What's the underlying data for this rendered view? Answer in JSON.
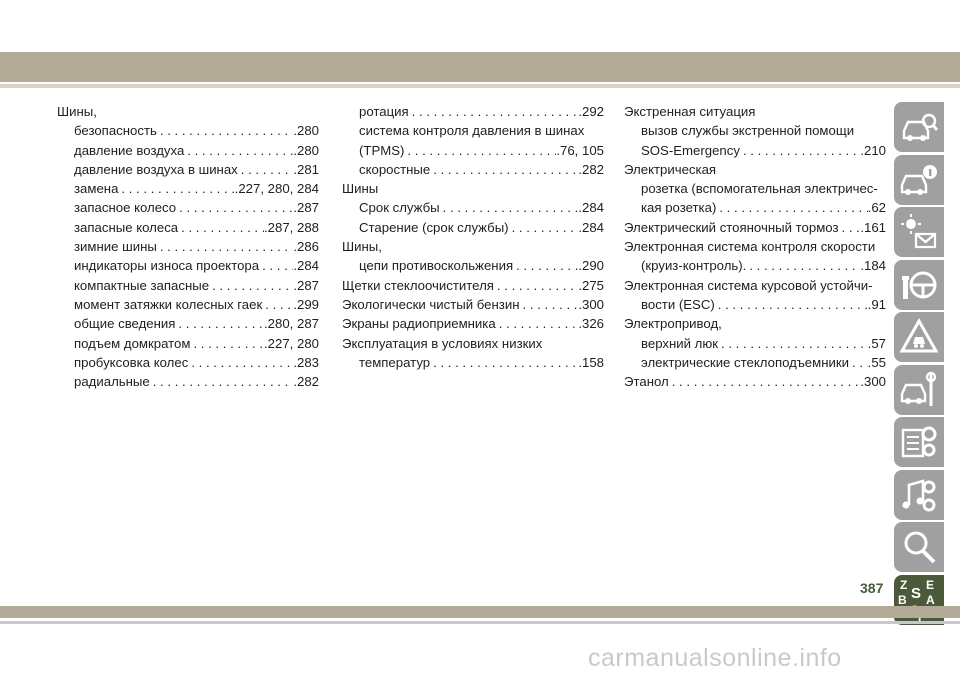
{
  "columns": [
    [
      {
        "level": 0,
        "text": "Шины,",
        "page": ""
      },
      {
        "level": 1,
        "text": "безопасность",
        "page": ".280"
      },
      {
        "level": 1,
        "text": "давление воздуха",
        "page": ".280"
      },
      {
        "level": 1,
        "text": "давление воздуха в шинах",
        "page": ".281"
      },
      {
        "level": 1,
        "text": "замена",
        "page": ".227, 280, 284"
      },
      {
        "level": 1,
        "text": "запасное колесо",
        "page": ".287"
      },
      {
        "level": 1,
        "text": "запасные колеса",
        "page": ".287, 288"
      },
      {
        "level": 1,
        "text": "зимние шины",
        "page": ".286"
      },
      {
        "level": 1,
        "text": "индикаторы износа проектора",
        "page": ".284"
      },
      {
        "level": 1,
        "text": "компактные запасные",
        "page": ".287"
      },
      {
        "level": 1,
        "text": "момент затяжки колесных гаек",
        "page": ".299"
      },
      {
        "level": 1,
        "text": "общие сведения",
        "page": ".280, 287"
      },
      {
        "level": 1,
        "text": "подъем домкратом",
        "page": ".227, 280"
      },
      {
        "level": 1,
        "text": "пробуксовка колес",
        "page": ".283"
      },
      {
        "level": 1,
        "text": "радиальные",
        "page": ".282"
      }
    ],
    [
      {
        "level": 1,
        "text": "ротация",
        "page": ".292"
      },
      {
        "level": 1,
        "text": "система контроля давления в шинах",
        "page": ""
      },
      {
        "level": 1,
        "text": "(TPMS)",
        "page": ".76, 105"
      },
      {
        "level": 1,
        "text": "скоростные",
        "page": ".282"
      },
      {
        "level": 0,
        "text": "Шины",
        "page": ""
      },
      {
        "level": 1,
        "text": "Срок службы",
        "page": ".284"
      },
      {
        "level": 1,
        "text": "Старение (срок службы)",
        "page": ".284"
      },
      {
        "level": 0,
        "text": "Шины,",
        "page": ""
      },
      {
        "level": 1,
        "text": "цепи противоскольжения",
        "page": ".290"
      },
      {
        "level": 0,
        "text": "Щетки стеклоочистителя",
        "page": ".275"
      },
      {
        "level": 0,
        "text": "Экологически чистый бензин",
        "page": ".300"
      },
      {
        "level": 0,
        "text": "Экраны радиоприемника",
        "page": ".326"
      },
      {
        "level": 0,
        "text": "Эксплуатация в условиях низких",
        "page": ""
      },
      {
        "level": 1,
        "text": "температур",
        "page": ".158"
      }
    ],
    [
      {
        "level": 0,
        "text": "Экстренная ситуация",
        "page": ""
      },
      {
        "level": 1,
        "text": "вызов службы экстренной помощи",
        "page": ""
      },
      {
        "level": 1,
        "text": "SOS-Emergency",
        "page": ".210"
      },
      {
        "level": 0,
        "text": "Электрическая",
        "page": ""
      },
      {
        "level": 1,
        "text": "розетка (вспомогательная электричес-",
        "page": ""
      },
      {
        "level": 1,
        "text": "кая розетка)",
        "page": ".62"
      },
      {
        "level": 0,
        "text": "Электрический стояночный тормоз",
        "page": ".161"
      },
      {
        "level": 0,
        "text": "Электронная система контроля скорости",
        "page": ""
      },
      {
        "level": 1,
        "text": "(круиз-контроль).",
        "page": ".184"
      },
      {
        "level": 0,
        "text": "Электронная система курсовой устойчи-",
        "page": ""
      },
      {
        "level": 1,
        "text": "вости (ESC)",
        "page": ".91"
      },
      {
        "level": 0,
        "text": "Электропривод,",
        "page": ""
      },
      {
        "level": 1,
        "text": "верхний люк",
        "page": ".57"
      },
      {
        "level": 1,
        "text": "электрические стеклоподъемники",
        "page": ".55"
      },
      {
        "level": 0,
        "text": "Этанол",
        "page": ".300"
      }
    ]
  ],
  "sidebar": {
    "tabs": [
      "car-search-icon",
      "car-info-icon",
      "warning-lights-icon",
      "steering-wheel-icon",
      "warning-triangle-icon",
      "car-wrench-icon",
      "spec-gear-icon",
      "music-gear-icon",
      "magnifier-icon",
      "alphabet-index-icon"
    ],
    "index_letters": [
      "Z",
      "E",
      "B",
      "S",
      "A",
      "I",
      "C",
      "T",
      "D"
    ]
  },
  "page_number": "387",
  "watermark": "carmanualsonline.info"
}
